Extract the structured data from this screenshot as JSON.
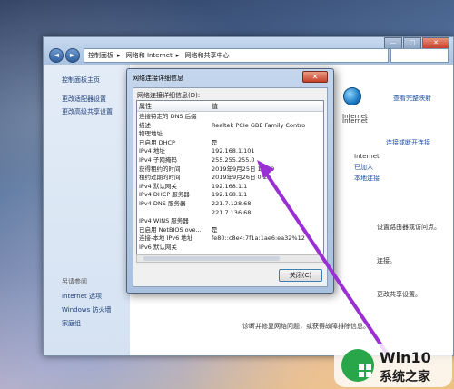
{
  "explorer": {
    "nav": {
      "back": "◄",
      "forward": "►"
    },
    "breadcrumb": [
      "控制面板",
      "网络和 Internet",
      "网络和共享中心"
    ],
    "left_pane": {
      "home": "控制面板主页",
      "change_adapter": "更改适配器设置",
      "change_sharing": "更改高级共享设置",
      "see_also": "另请参阅",
      "see_also_items": [
        "Internet 选项",
        "Windows 防火墙",
        "家庭组"
      ]
    },
    "right_pane": {
      "view_full_map": "查看完整映射",
      "internet_label": "Internet",
      "connect_or_disconnect": "连接或断开连接",
      "access_type_label": "Internet",
      "homegroup": "已加入",
      "local_connection": "本地连接",
      "fragments": [
        "设置路由器或访问点。",
        "连接。",
        "更改共享设置。",
        "诊断并修复网络问题，或获得故障排除信息。"
      ]
    },
    "controls": {
      "minimize": "—",
      "maximize": "□",
      "close": "✕"
    }
  },
  "dialog": {
    "title": "网络连接详细信息",
    "close_glyph": "✕",
    "group_label": "网络连接详细信息(D):",
    "columns": [
      "属性",
      "值"
    ],
    "rows": [
      {
        "prop": "连接特定的 DNS 后缀",
        "value": ""
      },
      {
        "prop": "描述",
        "value": "Realtek PCIe GBE Family Contro"
      },
      {
        "prop": "物理地址",
        "value": ""
      },
      {
        "prop": "已启用 DHCP",
        "value": "是"
      },
      {
        "prop": "IPv4 地址",
        "value": "192.168.1.101"
      },
      {
        "prop": "IPv4 子网掩码",
        "value": "255.255.255.0"
      },
      {
        "prop": "获得租约的时间",
        "value": "2019年9月25日 16:29"
      },
      {
        "prop": "租约过期的时间",
        "value": "2019年9月26日 0:22"
      },
      {
        "prop": "IPv4 默认网关",
        "value": "192.168.1.1"
      },
      {
        "prop": "IPv4 DHCP 服务器",
        "value": "192.168.1.1"
      },
      {
        "prop": "IPv4 DNS 服务器",
        "value": "221.7.128.68"
      },
      {
        "prop": "",
        "value": "221.7.136.68"
      },
      {
        "prop": "IPv4 WINS 服务器",
        "value": ""
      },
      {
        "prop": "已启用 NetBIOS ove...",
        "value": "是"
      },
      {
        "prop": "连接-本地 IPv6 地址",
        "value": "fe80::c8e4:7f1a:1ae6:ea32%12"
      },
      {
        "prop": "IPv6 默认网关",
        "value": ""
      }
    ],
    "close_button": "关闭(C)"
  },
  "watermark": {
    "brand": "Win10",
    "site": "系统之家"
  },
  "colors": {
    "arrow": "#9a2fd3",
    "logo_green": "#2aa64a",
    "link_blue": "#1e4f9e"
  }
}
